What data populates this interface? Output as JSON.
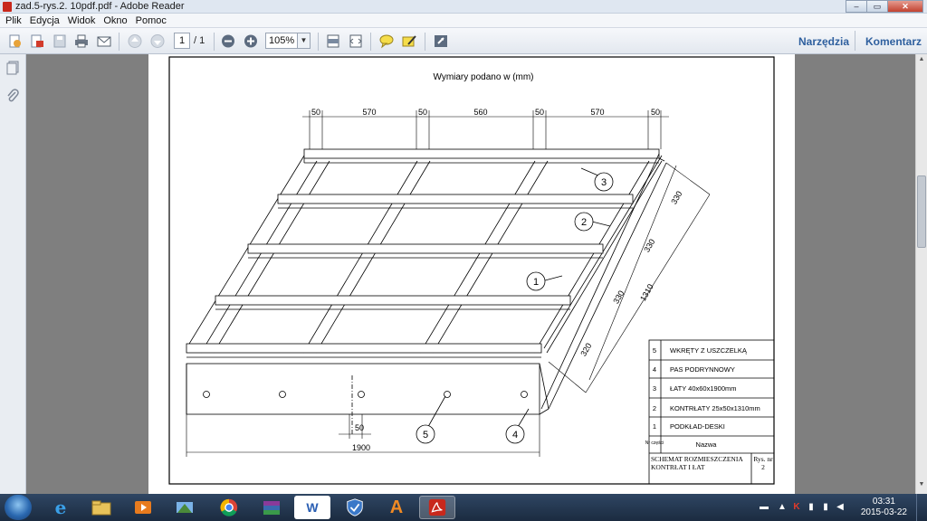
{
  "window": {
    "title": "zad.5-rys.2. 10pdf.pdf - Adobe Reader",
    "controls": {
      "minimize": "–",
      "maximize": "▭",
      "close": "✕"
    }
  },
  "menu": {
    "items": [
      "Plik",
      "Edycja",
      "Widok",
      "Okno",
      "Pomoc"
    ]
  },
  "toolbar": {
    "page_current": "1",
    "page_total": "/ 1",
    "zoom": "105%",
    "tools_link": "Narzędzia",
    "comment_link": "Komentarz"
  },
  "document": {
    "header": "Wymiary podano w (mm)",
    "top_dims": [
      "50",
      "570",
      "50",
      "560",
      "50",
      "570",
      "50"
    ],
    "side_dims": [
      "330",
      "330",
      "330",
      "320"
    ],
    "total_depth": "1310",
    "bottom_dim_small": "50",
    "bottom_dim_total": "1900",
    "callouts": [
      "1",
      "2",
      "3",
      "4",
      "5"
    ],
    "legend": {
      "rows": [
        {
          "num": "5",
          "name": "WKRĘTY Z USZCZELKĄ"
        },
        {
          "num": "4",
          "name": "PAS PODRYNNOWY"
        },
        {
          "num": "3",
          "name": "ŁATY 40x60x1900mm"
        },
        {
          "num": "2",
          "name": "KONTRŁATY 25x50x1310mm"
        },
        {
          "num": "1",
          "name": "PODKŁAD-DESKI"
        }
      ],
      "header_num": "Nr części",
      "header_name": "Nazwa",
      "footer_title": "SCHEMAT ROZMIESZCZENIA KONTRŁAT I ŁAT",
      "footer_ref": "Rys. nr 2"
    }
  },
  "taskbar": {
    "apps": [
      "e",
      "W",
      "A"
    ],
    "clock_time": "03:31",
    "clock_date": "2015-03-22"
  }
}
